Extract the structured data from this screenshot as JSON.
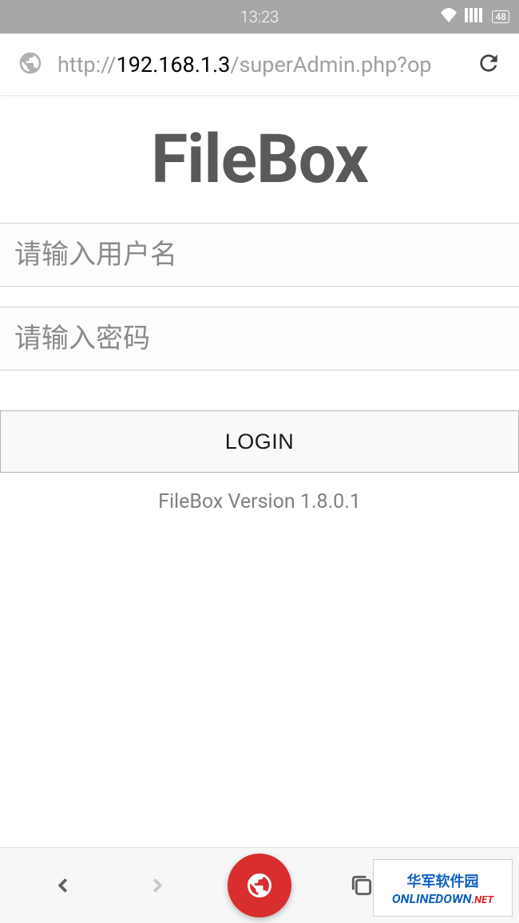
{
  "status": {
    "time": "13:23",
    "battery": "48"
  },
  "url": {
    "prefix": "http://",
    "ip": "192.168.1.3",
    "path": "/superAdmin.php?op"
  },
  "app": {
    "title": "FileBox",
    "version": "FileBox Version 1.8.0.1"
  },
  "form": {
    "username_placeholder": "请输入用户名",
    "password_placeholder": "请输入密码",
    "login_label": "LOGIN"
  },
  "watermark": {
    "cn": "华军软件园",
    "en": "ONLINEDOWN",
    "net": ".NET"
  }
}
